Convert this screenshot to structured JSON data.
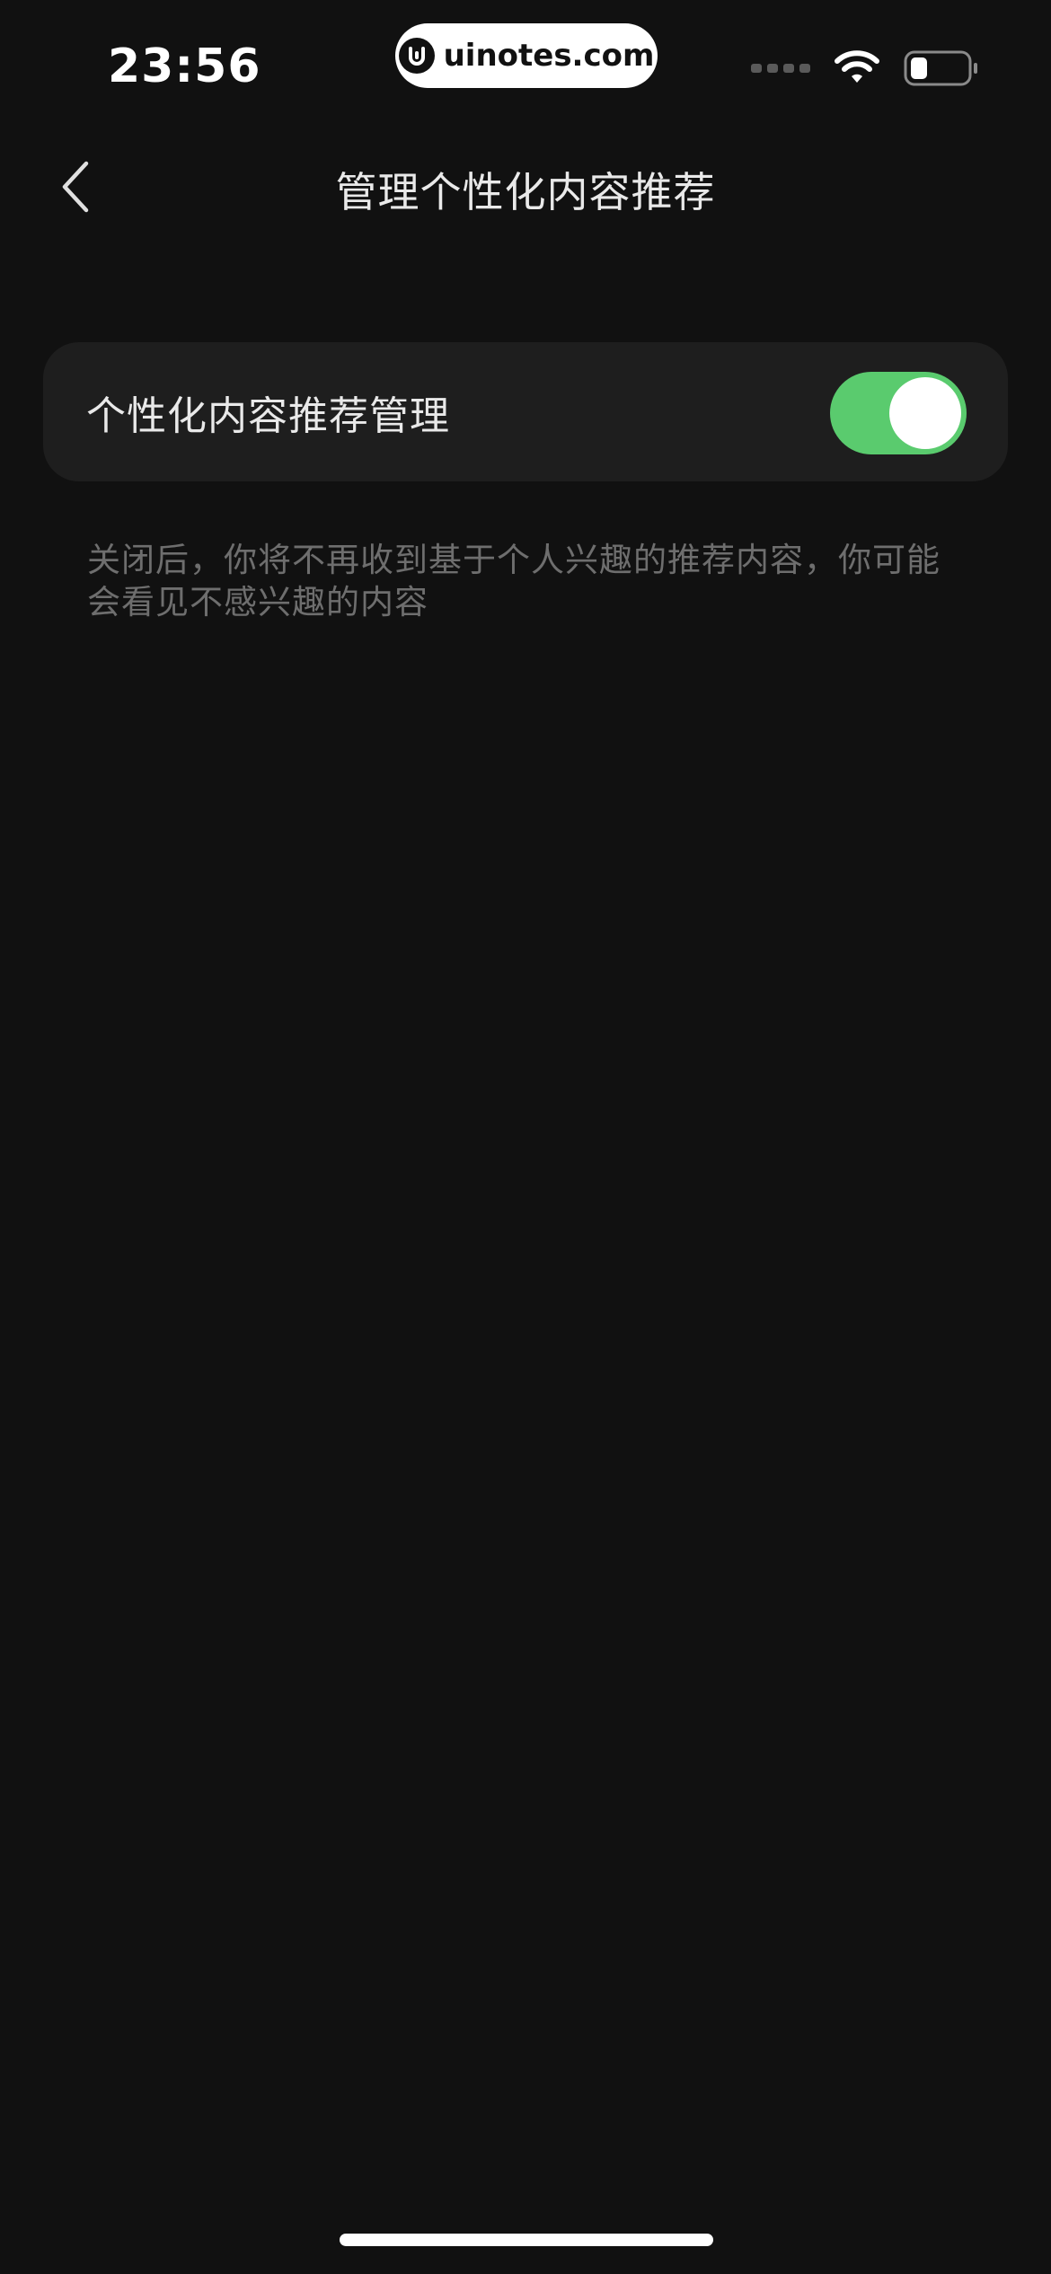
{
  "status_bar": {
    "time": "23:56",
    "watermark": "uinotes.com",
    "battery_level": 0.3
  },
  "nav": {
    "title": "管理个性化内容推荐"
  },
  "settings": {
    "personalized_recommendation": {
      "label": "个性化内容推荐管理",
      "enabled": true
    },
    "description": "关闭后，你将不再收到基于个人兴趣的推荐内容，你可能会看见不感兴趣的内容"
  },
  "colors": {
    "background": "#111111",
    "card": "#1e1e1e",
    "toggle_on": "#5acb6e",
    "description_text": "#6e6e6e"
  }
}
